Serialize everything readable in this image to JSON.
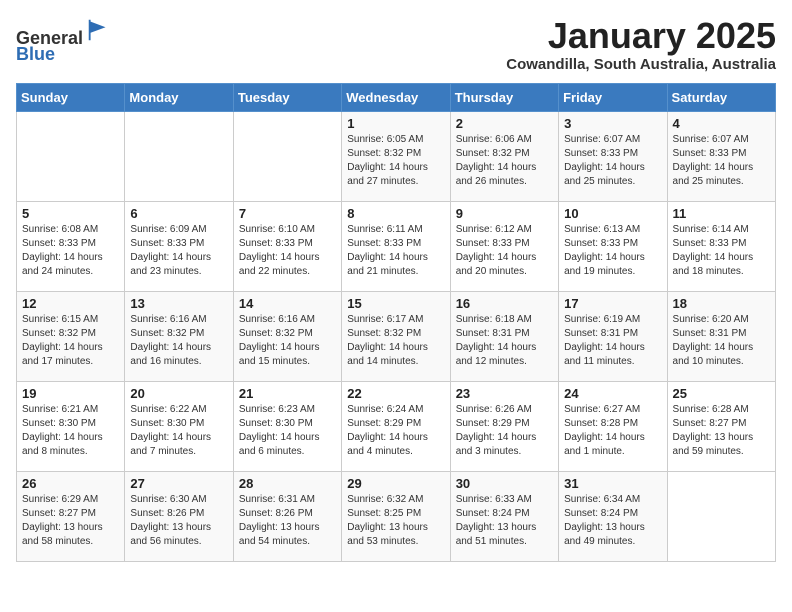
{
  "header": {
    "logo_line1": "General",
    "logo_line2": "Blue",
    "month": "January 2025",
    "location": "Cowandilla, South Australia, Australia"
  },
  "days_of_week": [
    "Sunday",
    "Monday",
    "Tuesday",
    "Wednesday",
    "Thursday",
    "Friday",
    "Saturday"
  ],
  "weeks": [
    [
      {
        "day": "",
        "info": ""
      },
      {
        "day": "",
        "info": ""
      },
      {
        "day": "",
        "info": ""
      },
      {
        "day": "1",
        "info": "Sunrise: 6:05 AM\nSunset: 8:32 PM\nDaylight: 14 hours\nand 27 minutes."
      },
      {
        "day": "2",
        "info": "Sunrise: 6:06 AM\nSunset: 8:32 PM\nDaylight: 14 hours\nand 26 minutes."
      },
      {
        "day": "3",
        "info": "Sunrise: 6:07 AM\nSunset: 8:33 PM\nDaylight: 14 hours\nand 25 minutes."
      },
      {
        "day": "4",
        "info": "Sunrise: 6:07 AM\nSunset: 8:33 PM\nDaylight: 14 hours\nand 25 minutes."
      }
    ],
    [
      {
        "day": "5",
        "info": "Sunrise: 6:08 AM\nSunset: 8:33 PM\nDaylight: 14 hours\nand 24 minutes."
      },
      {
        "day": "6",
        "info": "Sunrise: 6:09 AM\nSunset: 8:33 PM\nDaylight: 14 hours\nand 23 minutes."
      },
      {
        "day": "7",
        "info": "Sunrise: 6:10 AM\nSunset: 8:33 PM\nDaylight: 14 hours\nand 22 minutes."
      },
      {
        "day": "8",
        "info": "Sunrise: 6:11 AM\nSunset: 8:33 PM\nDaylight: 14 hours\nand 21 minutes."
      },
      {
        "day": "9",
        "info": "Sunrise: 6:12 AM\nSunset: 8:33 PM\nDaylight: 14 hours\nand 20 minutes."
      },
      {
        "day": "10",
        "info": "Sunrise: 6:13 AM\nSunset: 8:33 PM\nDaylight: 14 hours\nand 19 minutes."
      },
      {
        "day": "11",
        "info": "Sunrise: 6:14 AM\nSunset: 8:33 PM\nDaylight: 14 hours\nand 18 minutes."
      }
    ],
    [
      {
        "day": "12",
        "info": "Sunrise: 6:15 AM\nSunset: 8:32 PM\nDaylight: 14 hours\nand 17 minutes."
      },
      {
        "day": "13",
        "info": "Sunrise: 6:16 AM\nSunset: 8:32 PM\nDaylight: 14 hours\nand 16 minutes."
      },
      {
        "day": "14",
        "info": "Sunrise: 6:16 AM\nSunset: 8:32 PM\nDaylight: 14 hours\nand 15 minutes."
      },
      {
        "day": "15",
        "info": "Sunrise: 6:17 AM\nSunset: 8:32 PM\nDaylight: 14 hours\nand 14 minutes."
      },
      {
        "day": "16",
        "info": "Sunrise: 6:18 AM\nSunset: 8:31 PM\nDaylight: 14 hours\nand 12 minutes."
      },
      {
        "day": "17",
        "info": "Sunrise: 6:19 AM\nSunset: 8:31 PM\nDaylight: 14 hours\nand 11 minutes."
      },
      {
        "day": "18",
        "info": "Sunrise: 6:20 AM\nSunset: 8:31 PM\nDaylight: 14 hours\nand 10 minutes."
      }
    ],
    [
      {
        "day": "19",
        "info": "Sunrise: 6:21 AM\nSunset: 8:30 PM\nDaylight: 14 hours\nand 8 minutes."
      },
      {
        "day": "20",
        "info": "Sunrise: 6:22 AM\nSunset: 8:30 PM\nDaylight: 14 hours\nand 7 minutes."
      },
      {
        "day": "21",
        "info": "Sunrise: 6:23 AM\nSunset: 8:30 PM\nDaylight: 14 hours\nand 6 minutes."
      },
      {
        "day": "22",
        "info": "Sunrise: 6:24 AM\nSunset: 8:29 PM\nDaylight: 14 hours\nand 4 minutes."
      },
      {
        "day": "23",
        "info": "Sunrise: 6:26 AM\nSunset: 8:29 PM\nDaylight: 14 hours\nand 3 minutes."
      },
      {
        "day": "24",
        "info": "Sunrise: 6:27 AM\nSunset: 8:28 PM\nDaylight: 14 hours\nand 1 minute."
      },
      {
        "day": "25",
        "info": "Sunrise: 6:28 AM\nSunset: 8:27 PM\nDaylight: 13 hours\nand 59 minutes."
      }
    ],
    [
      {
        "day": "26",
        "info": "Sunrise: 6:29 AM\nSunset: 8:27 PM\nDaylight: 13 hours\nand 58 minutes."
      },
      {
        "day": "27",
        "info": "Sunrise: 6:30 AM\nSunset: 8:26 PM\nDaylight: 13 hours\nand 56 minutes."
      },
      {
        "day": "28",
        "info": "Sunrise: 6:31 AM\nSunset: 8:26 PM\nDaylight: 13 hours\nand 54 minutes."
      },
      {
        "day": "29",
        "info": "Sunrise: 6:32 AM\nSunset: 8:25 PM\nDaylight: 13 hours\nand 53 minutes."
      },
      {
        "day": "30",
        "info": "Sunrise: 6:33 AM\nSunset: 8:24 PM\nDaylight: 13 hours\nand 51 minutes."
      },
      {
        "day": "31",
        "info": "Sunrise: 6:34 AM\nSunset: 8:24 PM\nDaylight: 13 hours\nand 49 minutes."
      },
      {
        "day": "",
        "info": ""
      }
    ]
  ]
}
